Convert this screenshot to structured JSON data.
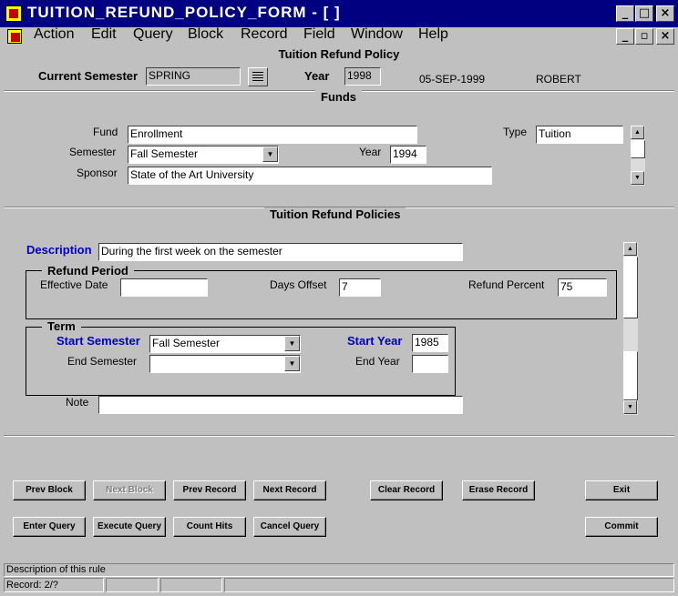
{
  "window": {
    "title": "TUITION_REFUND_POLICY_FORM - [ ]"
  },
  "menu": [
    {
      "label": "Action"
    },
    {
      "label": "Edit"
    },
    {
      "label": "Query"
    },
    {
      "label": "Block"
    },
    {
      "label": "Record"
    },
    {
      "label": "Field"
    },
    {
      "label": "Window"
    },
    {
      "label": "Help"
    }
  ],
  "form": {
    "title": "Tuition Refund Policy"
  },
  "header": {
    "semester_label": "Current Semester",
    "semester_value": "SPRING",
    "year_label": "Year",
    "year_value": "1998",
    "date": "05-SEP-1999",
    "user": "ROBERT"
  },
  "funds": {
    "section_title": "Funds",
    "fund_label": "Fund",
    "fund_value": "Enrollment",
    "type_label": "Type",
    "type_value": "Tuition",
    "semester_label": "Semester",
    "semester_value": "Fall Semester",
    "year_label": "Year",
    "year_value": "1994",
    "sponsor_label": "Sponsor",
    "sponsor_value": "State of the Art University"
  },
  "policies": {
    "section_title": "Tuition Refund Policies",
    "description_label": "Description",
    "description_value": "During the first week on the semester",
    "refund_period_title": "Refund Period",
    "effective_date_label": "Effective Date",
    "effective_date_value": "",
    "days_offset_label": "Days Offset",
    "days_offset_value": "7",
    "refund_percent_label": "Refund Percent",
    "refund_percent_value": "75",
    "term_title": "Term",
    "start_semester_label": "Start Semester",
    "start_semester_value": "Fall Semester",
    "start_year_label": "Start Year",
    "start_year_value": "1985",
    "end_semester_label": "End Semester",
    "end_semester_value": "",
    "end_year_label": "End Year",
    "end_year_value": "",
    "note_label": "Note",
    "note_value": ""
  },
  "buttons": {
    "prev_block": "Prev Block",
    "next_block": "Next Block",
    "prev_record": "Prev Record",
    "next_record": "Next Record",
    "clear_record": "Clear Record",
    "erase_record": "Erase Record",
    "exit": "Exit",
    "enter_query": "Enter Query",
    "execute_query": "Execute Query",
    "count_hits": "Count Hits",
    "cancel_query": "Cancel Query",
    "commit": "Commit"
  },
  "status": {
    "hint": "Description of this rule",
    "record": "Record: 2/?"
  },
  "colors": {
    "titlebar": "#000080",
    "label_blue": "#0000c0",
    "background": "#c0c0c0"
  }
}
